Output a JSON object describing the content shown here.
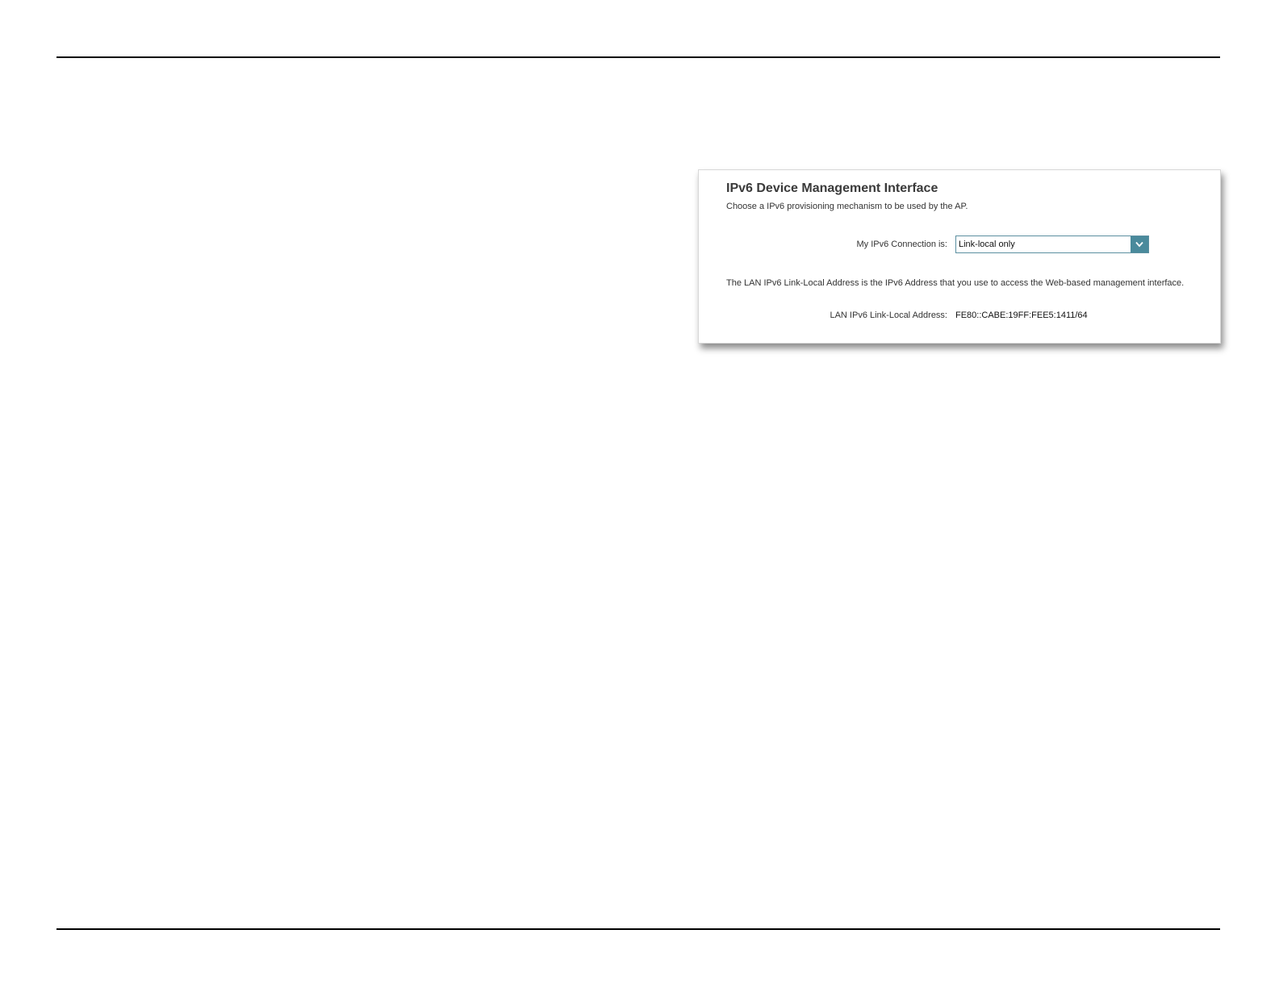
{
  "panel": {
    "title": "IPv6 Device Management Interface",
    "description": "Choose a IPv6 provisioning mechanism to be used by the AP.",
    "connection": {
      "label": "My IPv6 Connection is:",
      "selected_value": "Link-local only",
      "arrow_icon": "chevron-down-icon",
      "accent_color": "#4a8a9c"
    },
    "info_text": "The LAN IPv6 Link-Local Address is the IPv6 Address that you use to access the Web-based management interface.",
    "link_local": {
      "label": "LAN IPv6 Link-Local Address:",
      "value": "FE80::CABE:19FF:FEE5:1411/64"
    }
  }
}
